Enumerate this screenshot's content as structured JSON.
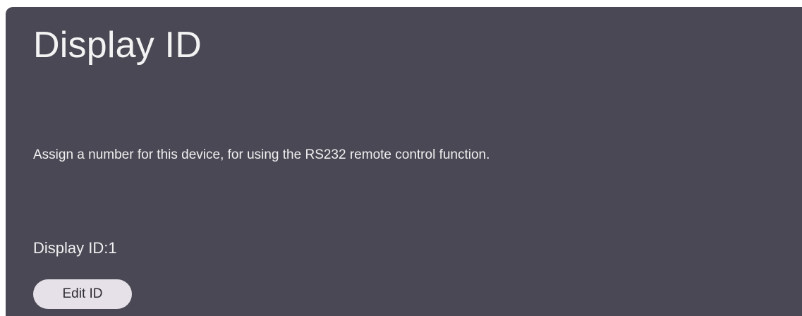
{
  "page": {
    "title": "Display ID",
    "description": "Assign a number for this device, for using the RS232 remote control function.",
    "display_id_label": "Display ID:1",
    "edit_button_label": "Edit ID"
  },
  "colors": {
    "panel_background": "#4a4854",
    "text": "#f3f3f3",
    "button_background": "#e6e1e8",
    "button_text": "#2d2b33"
  }
}
